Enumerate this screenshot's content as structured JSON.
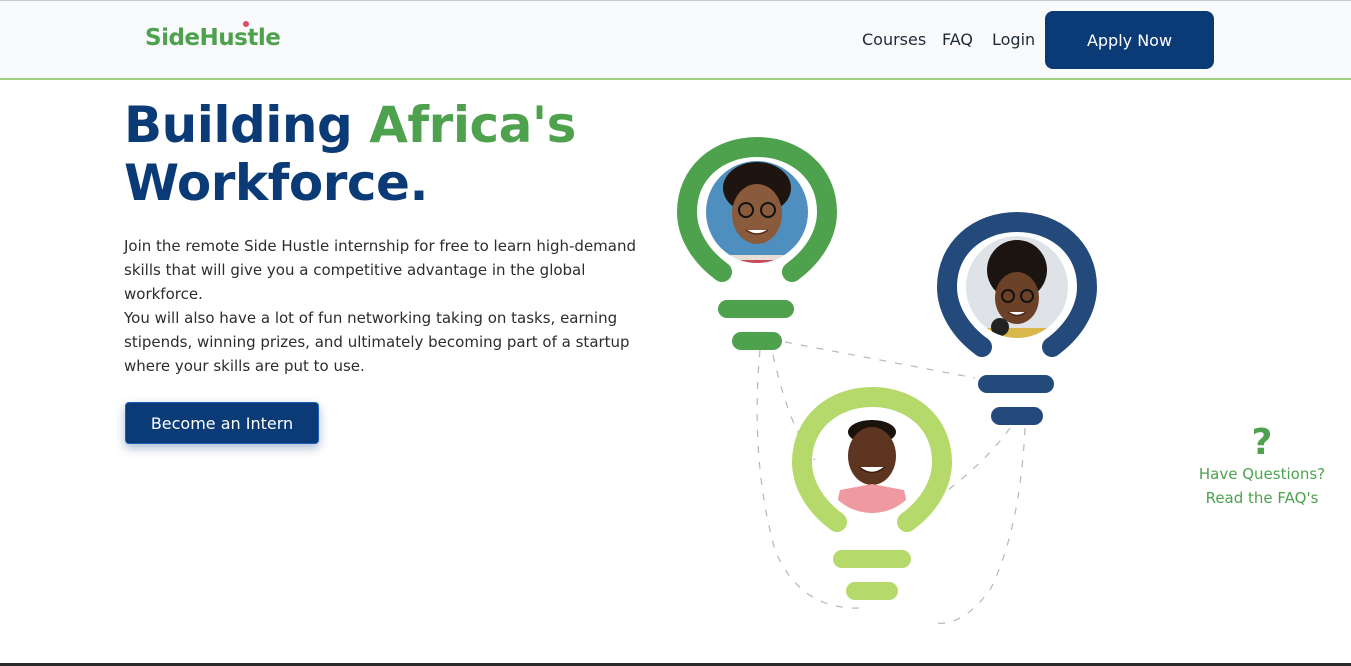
{
  "header": {
    "logo_text": "SideHustle",
    "nav": [
      "Courses",
      "FAQ",
      "Login"
    ],
    "apply_label": "Apply Now"
  },
  "hero": {
    "title_part1": "Building ",
    "title_highlight": "Africa's",
    "title_part2": "Workforce.",
    "description_line1": "Join the remote Side Hustle internship for free to learn high-demand skills that will give you a competitive advantage in the global workforce.",
    "description_line2": "You will also have a lot of fun networking taking on tasks, earning stipends, winning prizes, and ultimately becoming part of a startup where your skills are put to use.",
    "cta_label": "Become an Intern"
  },
  "faq_help": {
    "icon": "?",
    "text": "Have Questions? Read the FAQ's"
  },
  "colors": {
    "brand_blue": "#0b3b76",
    "brand_green": "#4ea24e",
    "light_green": "#b5d96b",
    "bulb_blue": "#234a7a"
  },
  "illustration": {
    "bulbs": [
      {
        "name": "green-bulb",
        "color": "#4ea24e",
        "person": "woman-with-glasses"
      },
      {
        "name": "blue-bulb",
        "color": "#234a7a",
        "person": "woman-with-headphones"
      },
      {
        "name": "light-green-bulb",
        "color": "#b5d96b",
        "person": "smiling-man"
      }
    ]
  }
}
